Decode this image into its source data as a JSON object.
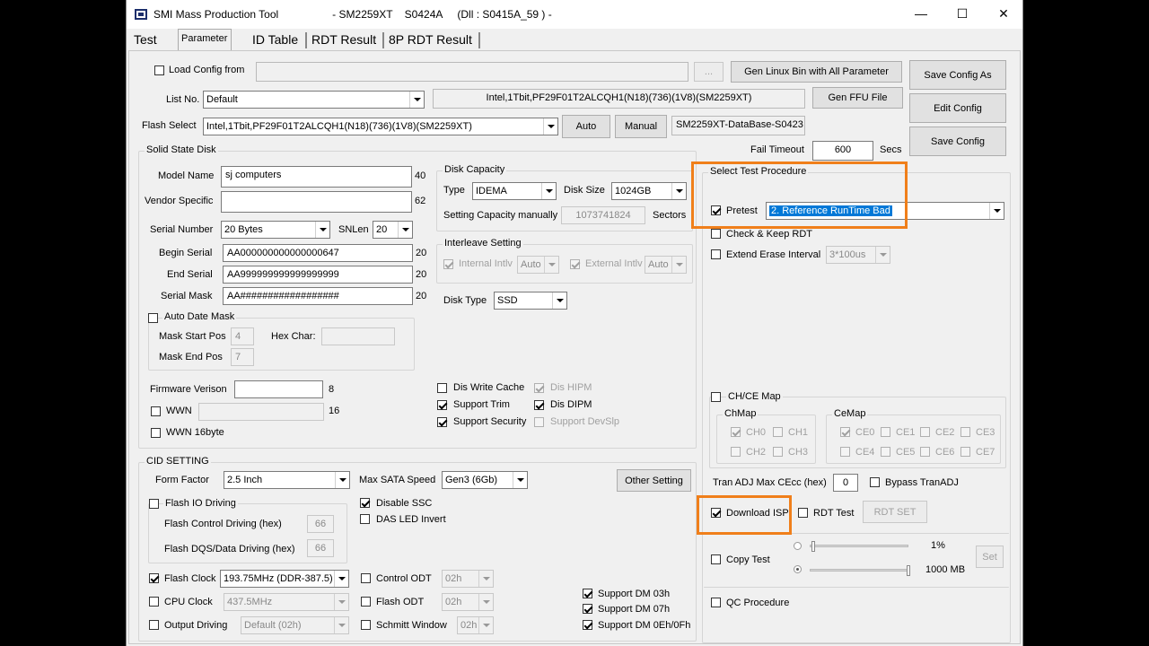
{
  "window": {
    "title": "SMI Mass Production Tool                  - SM2259XT    S0424A     (Dll : S0415A_59 ) -",
    "minimize": "—",
    "maximize": "☐",
    "close": "✕"
  },
  "tabs": [
    "Test",
    "Parameter",
    "ID Table",
    "RDT Result",
    "8P RDT Result"
  ],
  "top": {
    "load_config_label": "Load Config from",
    "load_config_path": "",
    "browse_label": "...",
    "gen_linux_label": "Gen Linux Bin with All Parameter",
    "save_as_label": "Save Config As",
    "list_no_label": "List No.",
    "list_no_value": "Default",
    "flash_info": "Intel,1Tbit,PF29F01T2ALCQH1(N18)(736)(1V8)(SM2259XT)",
    "gen_ffu_label": "Gen FFU File",
    "edit_config_label": "Edit Config",
    "flash_select_label": "Flash Select",
    "flash_select_value": "Intel,1Tbit,PF29F01T2ALCQH1(N18)(736)(1V8)(SM2259XT)",
    "auto_label": "Auto",
    "manual_label": "Manual",
    "database": "SM2259XT-DataBase-S0423",
    "save_config_label": "Save Config",
    "fail_timeout_label": "Fail Timeout",
    "fail_timeout_value": "600",
    "secs_label": "Secs"
  },
  "ssd": {
    "title": "Solid State Disk",
    "model_name_label": "Model Name",
    "model_name": "sj computers",
    "model_len": "40",
    "vendor_label": "Vendor Specific",
    "vendor": "",
    "vendor_len": "62",
    "serial_number_label": "Serial Number",
    "serial_number": "20 Bytes",
    "snlen_label": "SNLen",
    "snlen": "20",
    "begin_serial_label": "Begin Serial",
    "begin_serial": "AA000000000000000647",
    "begin_len": "20",
    "end_serial_label": "End Serial",
    "end_serial": "AA999999999999999999",
    "end_len": "20",
    "serial_mask_label": "Serial Mask",
    "serial_mask": "AA##################",
    "mask_len": "20",
    "auto_date_mask_label": "Auto Date Mask",
    "mask_start_label": "Mask Start Pos",
    "mask_start": "4",
    "hex_char_label": "Hex Char:",
    "hex_char": "",
    "mask_end_label": "Mask End Pos",
    "mask_end": "7",
    "firmware_label": "Firmware Verison",
    "firmware": "",
    "firmware_len": "8",
    "wwn_label": "WWN",
    "wwn": "",
    "wwn_len": "16",
    "wwn16_label": "WWN 16byte"
  },
  "capacity": {
    "title": "Disk Capacity",
    "type_label": "Type",
    "type": "IDEMA",
    "size_label": "Disk Size",
    "size": "1024GB",
    "manual_label": "Setting Capacity manually",
    "manual_value": "1073741824",
    "sectors_label": "Sectors"
  },
  "interleave": {
    "title": "Interleave Setting",
    "internal_label": "Internal Intlv",
    "internal": "Auto",
    "external_label": "External Intlv",
    "external": "Auto"
  },
  "disk_type": {
    "label": "Disk Type",
    "value": "SSD"
  },
  "feature_checks": {
    "dis_write_cache": "Dis Write Cache",
    "dis_hipm": "Dis HIPM",
    "support_trim": "Support Trim",
    "dis_dipm": "Dis DIPM",
    "support_security": "Support Security",
    "support_devslp": "Support DevSlp"
  },
  "cid": {
    "title": "CID SETTING",
    "form_factor_label": "Form Factor",
    "form_factor": "2.5 Inch",
    "max_sata_label": "Max SATA Speed",
    "max_sata": "Gen3 (6Gb)",
    "other_setting_label": "Other Setting",
    "flash_io_label": "Flash IO Driving",
    "flash_ctrl_label": "Flash Control Driving (hex)",
    "flash_ctrl": "66",
    "flash_dqs_label": "Flash DQS/Data Driving (hex)",
    "flash_dqs": "66",
    "disable_ssc_label": "Disable SSC",
    "das_led_label": "DAS LED Invert",
    "flash_clock_label": "Flash Clock",
    "flash_clock": "193.75MHz (DDR-387.5)",
    "control_odt_label": "Control ODT",
    "control_odt": "02h",
    "cpu_clock_label": "CPU Clock",
    "cpu_clock": "437.5MHz",
    "flash_odt_label": "Flash ODT",
    "flash_odt": "02h",
    "output_driving_label": "Output Driving",
    "output_driving": "Default (02h)",
    "schmitt_label": "Schmitt Window",
    "schmitt": "02h",
    "dm03_label": "Support DM 03h",
    "dm07_label": "Support DM 07h",
    "dm0e_label": "Support DM 0Eh/0Fh"
  },
  "procedure": {
    "title": "Select Test Procedure",
    "pretest_label": "Pretest",
    "pretest_value": "2. Reference RunTime Bad",
    "check_keep_label": "Check & Keep RDT",
    "extend_erase_label": "Extend Erase Interval",
    "extend_erase_value": "3*100us",
    "chce_map_label": "CH/CE Map",
    "chmap_title": "ChMap",
    "ch": [
      "CH0",
      "CH1",
      "CH2",
      "CH3"
    ],
    "cemap_title": "CeMap",
    "ce": [
      "CE0",
      "CE1",
      "CE2",
      "CE3",
      "CE4",
      "CE5",
      "CE6",
      "CE7"
    ],
    "tran_adj_label": "Tran ADJ Max CEcc (hex)",
    "tran_adj": "0",
    "bypass_label": "Bypass TranADJ",
    "download_isp_label": "Download ISP",
    "rdt_test_label": "RDT Test",
    "rdt_set_label": "RDT SET",
    "copy_test_label": "Copy Test",
    "percent": "1%",
    "mb": "1000 MB",
    "set_label": "Set",
    "qc_label": "QC Procedure"
  },
  "colors": {
    "highlight": "#f07f1a",
    "selection": "#0078d7"
  }
}
